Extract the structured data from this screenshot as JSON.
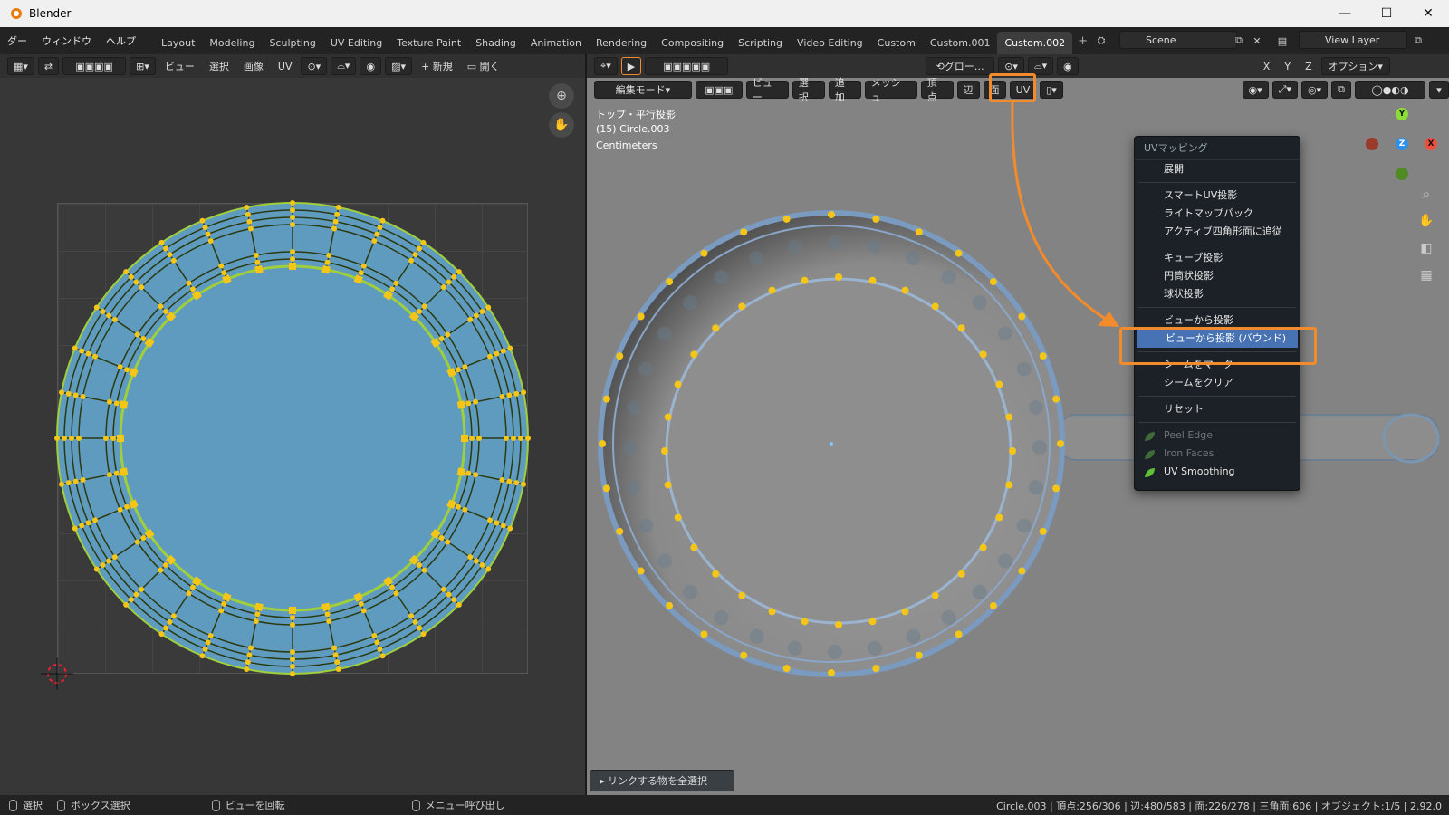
{
  "window": {
    "title": "Blender",
    "min": "—",
    "max": "☐",
    "close": "✕"
  },
  "menubar": {
    "items": [
      "ダー",
      "ウィンドウ",
      "ヘルプ"
    ],
    "tabs": [
      {
        "label": "Layout",
        "active": false
      },
      {
        "label": "Modeling",
        "active": false
      },
      {
        "label": "Sculpting",
        "active": false
      },
      {
        "label": "UV Editing",
        "active": false
      },
      {
        "label": "Texture Paint",
        "active": false
      },
      {
        "label": "Shading",
        "active": false
      },
      {
        "label": "Animation",
        "active": false
      },
      {
        "label": "Rendering",
        "active": false
      },
      {
        "label": "Compositing",
        "active": false
      },
      {
        "label": "Scripting",
        "active": false
      },
      {
        "label": "Video Editing",
        "active": false
      },
      {
        "label": "Custom",
        "active": false
      },
      {
        "label": "Custom.001",
        "active": false
      },
      {
        "label": "Custom.002",
        "active": true
      }
    ],
    "add_tab": "+",
    "scene": "Scene",
    "view_layer": "View Layer"
  },
  "uv_header": {
    "view": "ビュー",
    "select": "選択",
    "image": "画像",
    "uv": "UV",
    "new": "新規",
    "open": "開く"
  },
  "viewport_header": {
    "transform_orientation": "グロー…",
    "options": "オプション",
    "axis_x": "X",
    "axis_y": "Y",
    "axis_z": "Z",
    "mode": "編集モード",
    "view": "ビュー",
    "select": "選択",
    "add": "追加",
    "mesh": "メッシュ",
    "vertex": "頂点",
    "edge": "辺",
    "face": "面",
    "uv": "UV"
  },
  "viewport_info": {
    "view_name": "トップ・平行投影",
    "object": "(15) Circle.003",
    "units": "Centimeters"
  },
  "uv_menu": {
    "title": "UVマッピング",
    "items": [
      {
        "label": "展開",
        "sep_after": true
      },
      {
        "label": "スマートUV投影"
      },
      {
        "label": "ライトマップパック"
      },
      {
        "label": "アクティブ四角形面に追従",
        "sep_after": true
      },
      {
        "label": "キューブ投影"
      },
      {
        "label": "円筒状投影"
      },
      {
        "label": "球状投影",
        "sep_after": true
      },
      {
        "label": "ビューから投影"
      },
      {
        "label": "ビューから投影 (バウンド)",
        "highlighted": true,
        "sep_after": true
      },
      {
        "label": "シームをマーク"
      },
      {
        "label": "シームをクリア",
        "sep_after": true
      },
      {
        "label": "リセット",
        "sep_after": true
      },
      {
        "label": "Peel Edge",
        "disabled": true,
        "icon": "leaf-icon"
      },
      {
        "label": "Iron Faces",
        "disabled": true,
        "icon": "leaf-icon"
      },
      {
        "label": "UV Smoothing",
        "icon": "leaf-icon"
      }
    ]
  },
  "link_button": "▸ リンクする物を全選択",
  "statusbar": {
    "select": "選択",
    "box_select": "ボックス選択",
    "rotate_view": "ビューを回転",
    "call_menu": "メニュー呼び出し",
    "stats": "Circle.003 | 頂点:256/306 | 辺:480/583 | 面:226/278 | 三角面:606 | オブジェクト:1/5 | 2.92.0"
  },
  "colors": {
    "accent": "#f28b2b",
    "highlight": "#4772b3",
    "uv_fill": "#5f9bbf",
    "vertex": "#f5c518",
    "edge": "#9fcf3a"
  }
}
